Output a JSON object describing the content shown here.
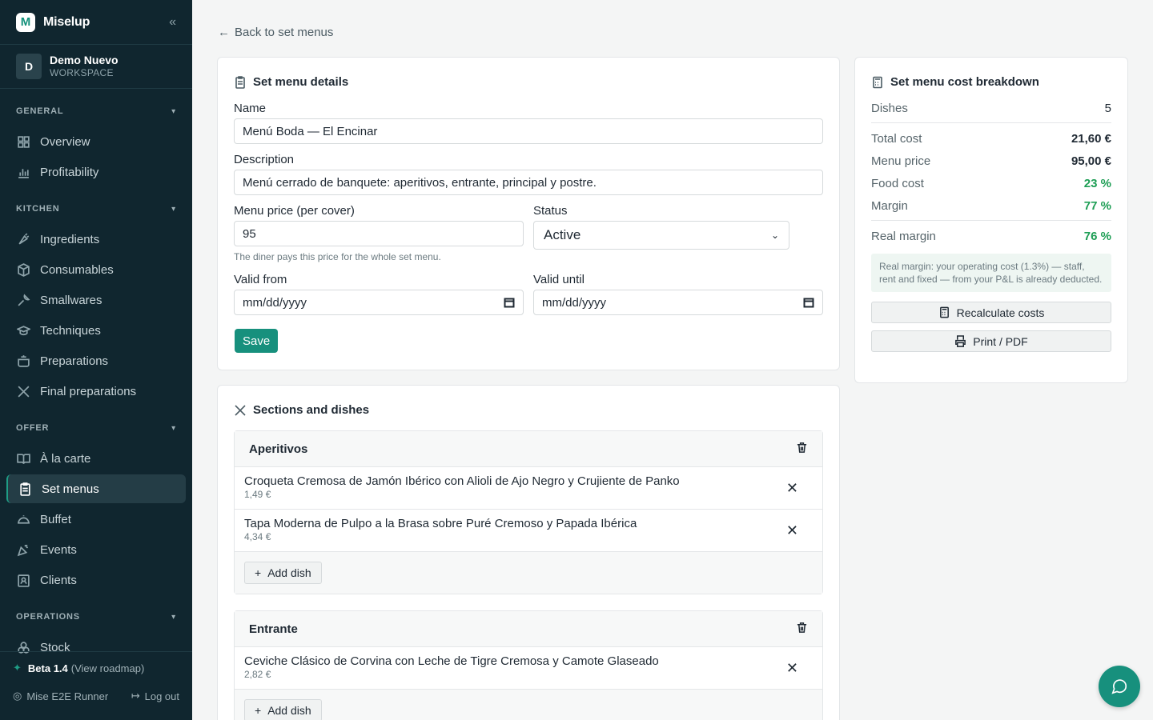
{
  "brand": {
    "logo_letter": "M",
    "name": "Miselup"
  },
  "workspace": {
    "initial": "D",
    "name": "Demo Nuevo",
    "subtitle": "WORKSPACE"
  },
  "sidebar": {
    "sections": [
      {
        "title": "GENERAL",
        "items": [
          "Overview",
          "Profitability"
        ]
      },
      {
        "title": "KITCHEN",
        "items": [
          "Ingredients",
          "Consumables",
          "Smallwares",
          "Techniques",
          "Preparations",
          "Final preparations"
        ]
      },
      {
        "title": "OFFER",
        "items": [
          "À la carte",
          "Set menus",
          "Buffet",
          "Events",
          "Clients"
        ]
      },
      {
        "title": "OPERATIONS",
        "items": [
          "Stock"
        ]
      }
    ],
    "active_item": "Set menus"
  },
  "footer": {
    "beta": "Beta 1.4",
    "roadmap": "(View roadmap)",
    "user": "Mise E2E Runner",
    "logout": "Log out"
  },
  "back_link": "Back to set menus",
  "details": {
    "title": "Set menu details",
    "name_label": "Name",
    "name_value": "Menú Boda — El Encinar",
    "description_label": "Description",
    "description_value": "Menú cerrado de banquete: aperitivos, entrante, principal y postre.",
    "price_label": "Menu price (per cover)",
    "price_value": "95",
    "price_hint": "The diner pays this price for the whole set menu.",
    "status_label": "Status",
    "status_value": "Active",
    "valid_from_label": "Valid from",
    "valid_until_label": "Valid until",
    "date_placeholder": "mm/dd/yyyy",
    "save_label": "Save"
  },
  "sections_card": {
    "title": "Sections and dishes",
    "add_dish_label": "Add dish",
    "sections": [
      {
        "name": "Aperitivos",
        "dishes": [
          {
            "name": "Croqueta Cremosa de Jamón Ibérico con Alioli de Ajo Negro y Crujiente de Panko",
            "price": "1,49 €"
          },
          {
            "name": "Tapa Moderna de Pulpo a la Brasa sobre Puré Cremoso y Papada Ibérica",
            "price": "4,34 €"
          }
        ]
      },
      {
        "name": "Entrante",
        "dishes": [
          {
            "name": "Ceviche Clásico de Corvina con Leche de Tigre Cremosa y Camote Glaseado",
            "price": "2,82 €"
          }
        ]
      }
    ]
  },
  "breakdown": {
    "title": "Set menu cost breakdown",
    "dishes_label": "Dishes",
    "dishes_value": "5",
    "total_cost_label": "Total cost",
    "total_cost_value": "21,60 €",
    "menu_price_label": "Menu price",
    "menu_price_value": "95,00 €",
    "food_cost_label": "Food cost",
    "food_cost_value": "23 %",
    "margin_label": "Margin",
    "margin_value": "77 %",
    "real_margin_label": "Real margin",
    "real_margin_value": "76 %",
    "note": "Real margin: your operating cost (1.3%) — staff, rent and fixed — from your P&L is already deducted.",
    "recalculate_label": "Recalculate costs",
    "print_label": "Print / PDF"
  },
  "colors": {
    "sidebar_bg": "#10262f",
    "accent": "#17907d",
    "positive": "#1e9e55"
  }
}
